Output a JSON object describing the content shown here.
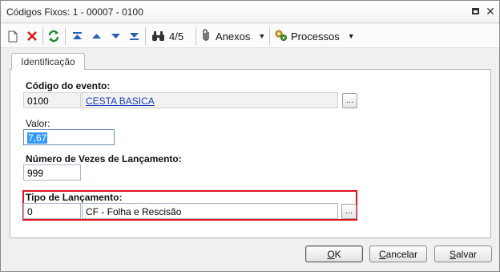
{
  "window": {
    "title": "Códigos Fixos: 1 - 00007 - 0100"
  },
  "toolbar": {
    "record_position": "4/5",
    "anexos_label": "Anexos",
    "processos_label": "Processos"
  },
  "tabs": [
    {
      "label": "Identificação"
    }
  ],
  "form": {
    "codigo_label": "Código do evento:",
    "codigo_value": "0100",
    "codigo_desc": "CESTA BASICA",
    "valor_label": "Valor:",
    "valor_value": "7,67",
    "numero_label": "Número de Vezes de Lançamento:",
    "numero_value": "999",
    "tipo_label": "Tipo de Lançamento:",
    "tipo_value": "0",
    "tipo_desc": "CF - Folha e Rescisão",
    "browse_label": "..."
  },
  "buttons": {
    "ok": {
      "hot": "O",
      "rest": "K"
    },
    "cancelar": {
      "hot": "C",
      "rest": "ancelar"
    },
    "salvar": {
      "hot": "S",
      "rest": "alvar"
    }
  },
  "colors": {
    "highlight": "#e0141e",
    "link": "#1a3bc0",
    "selection": "#3399ff"
  }
}
